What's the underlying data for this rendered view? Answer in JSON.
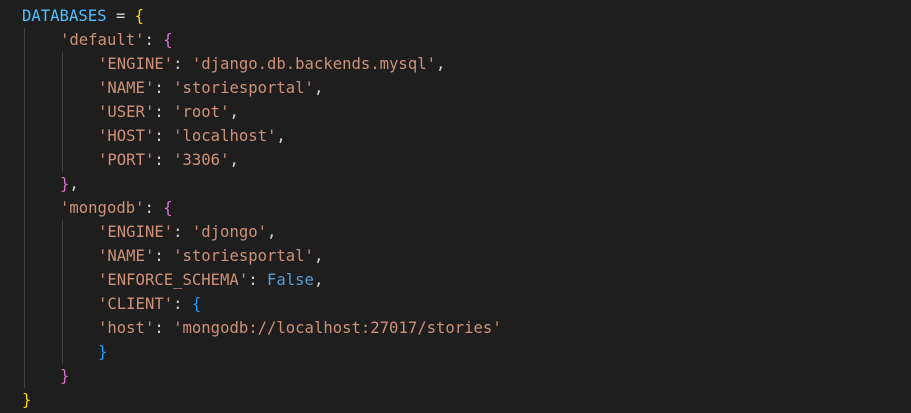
{
  "colors": {
    "background": "#1e1e1e",
    "variable": "#4fc1ff",
    "string": "#ce9178",
    "constant": "#569cd6",
    "bracket_level1": "#ffd700",
    "bracket_level2": "#da70d6",
    "bracket_level3": "#179fff",
    "punctuation": "#d4d4d4"
  },
  "code": {
    "var_name": "DATABASES",
    "assign": " = ",
    "open_outer": "{",
    "close_outer": "}",
    "default_key": "'default'",
    "mongodb_key": "'mongodb'",
    "colon": ": ",
    "comma": ",",
    "open_brace": "{",
    "close_brace": "}",
    "default_close": "},",
    "default_entries": [
      {
        "key": "'ENGINE'",
        "value": "'django.db.backends.mysql'"
      },
      {
        "key": "'NAME'",
        "value": "'storiesportal'"
      },
      {
        "key": "'USER'",
        "value": "'root'"
      },
      {
        "key": "'HOST'",
        "value": "'localhost'"
      },
      {
        "key": "'PORT'",
        "value": "'3306'"
      }
    ],
    "mongodb_entries": [
      {
        "key": "'ENGINE'",
        "value": "'djongo'"
      },
      {
        "key": "'NAME'",
        "value": "'storiesportal'"
      }
    ],
    "enforce_schema_key": "'ENFORCE_SCHEMA'",
    "enforce_schema_value": "False",
    "client_key": "'CLIENT'",
    "host_key": "'host'",
    "host_value": "'mongodb://localhost:27017/stories'"
  }
}
